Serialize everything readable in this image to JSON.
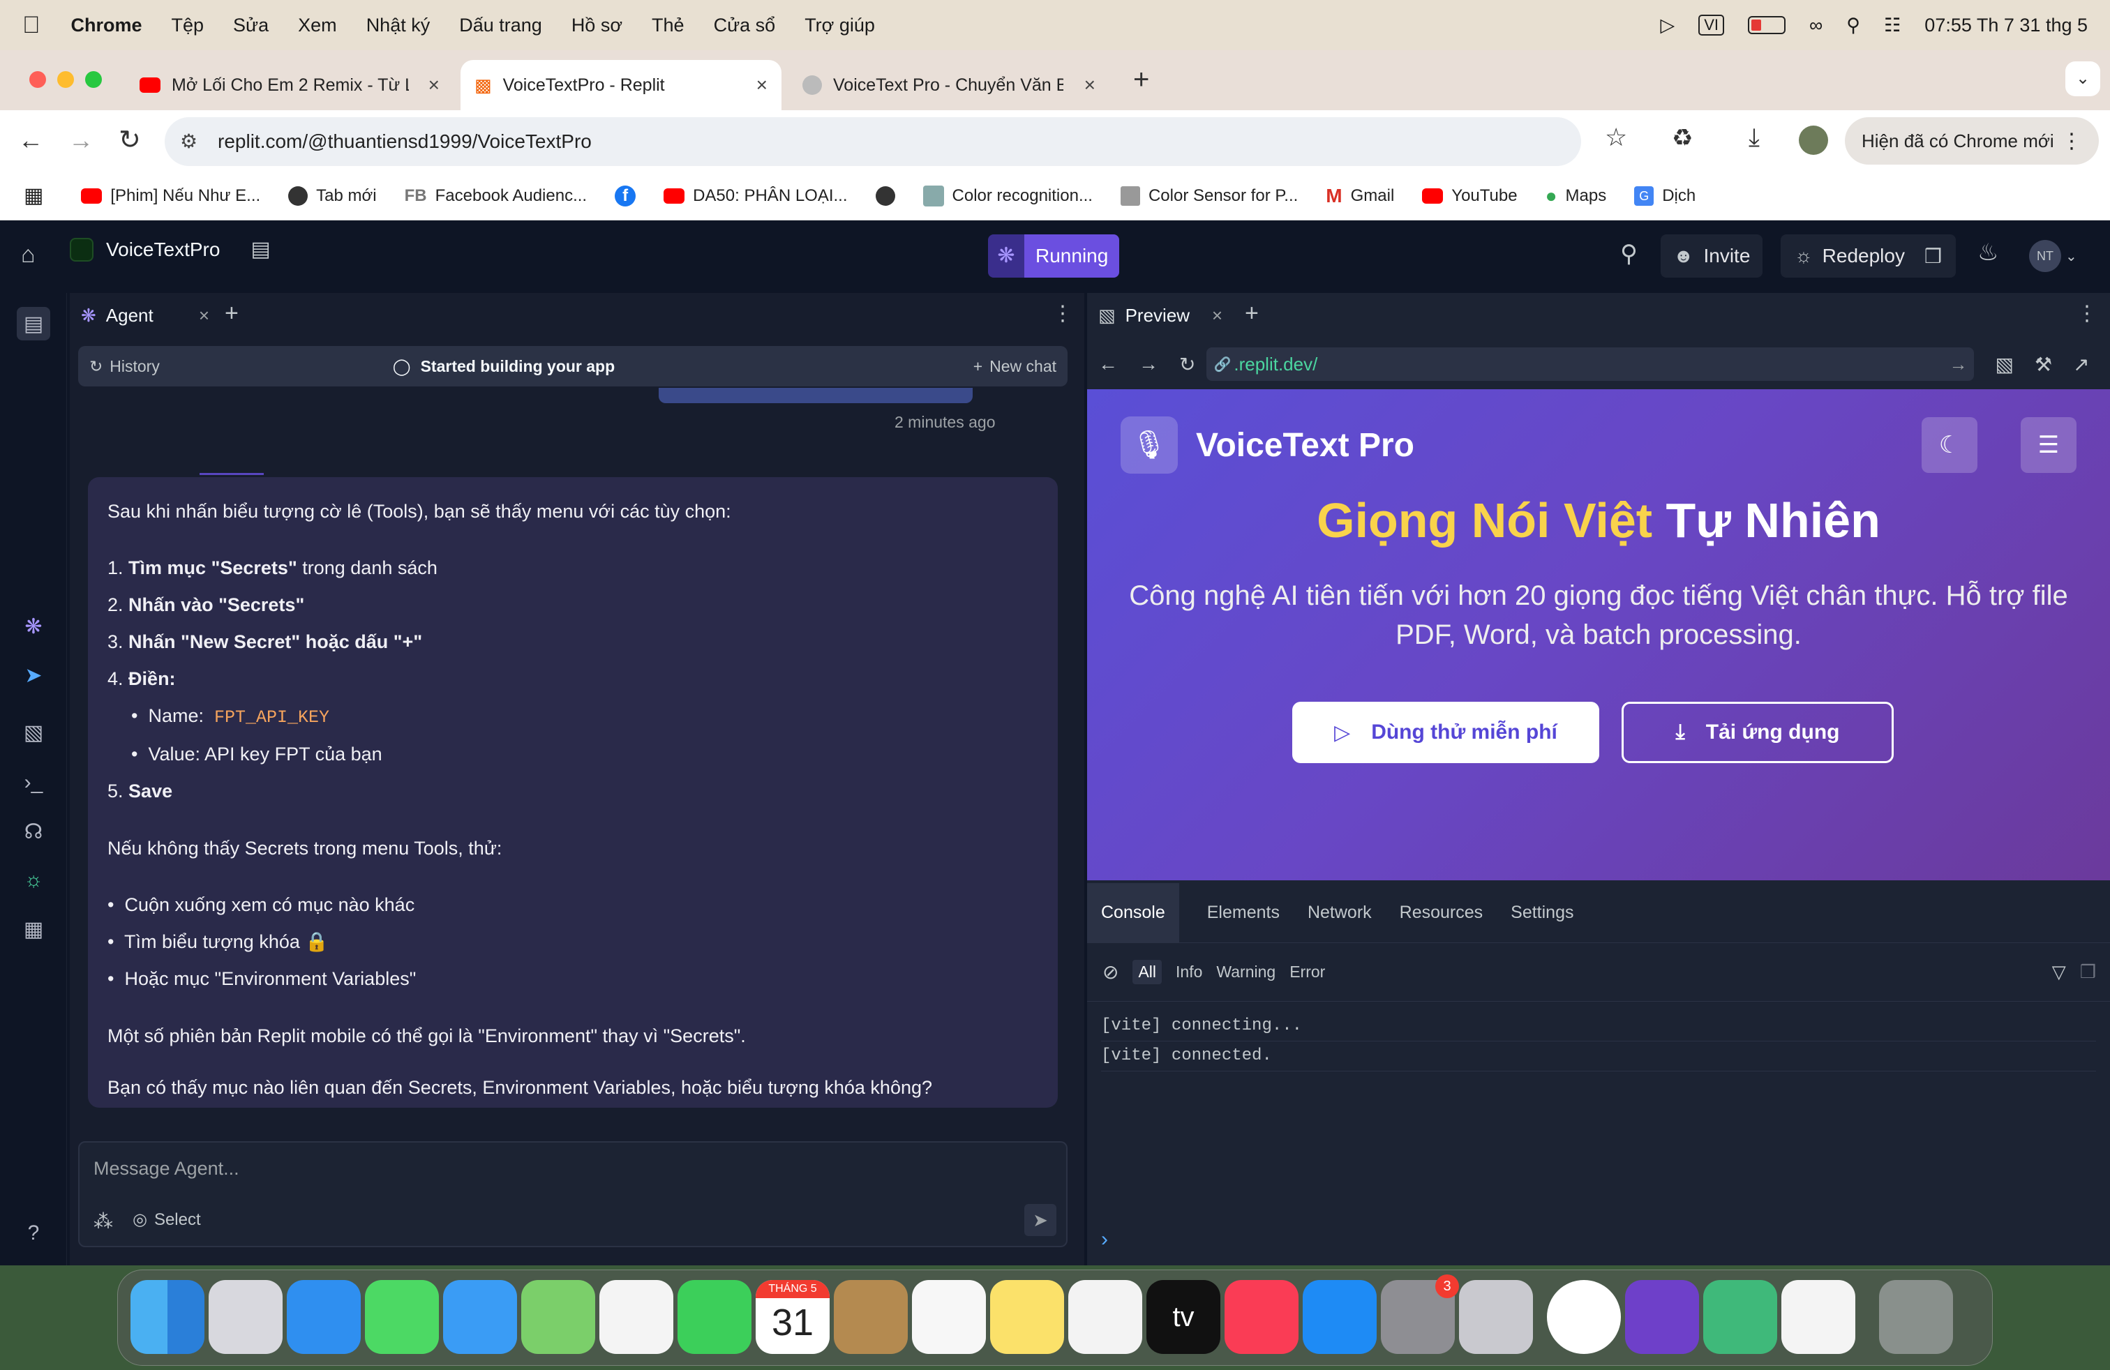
{
  "menubar": {
    "app": "Chrome",
    "items": [
      "Tệp",
      "Sửa",
      "Xem",
      "Nhật ký",
      "Dấu trang",
      "Hồ sơ",
      "Thẻ",
      "Cửa sổ",
      "Trợ giúp"
    ],
    "input_method": "VI",
    "clock": "07:55 Th 7 31 thg 5"
  },
  "tabs": [
    {
      "title": "Mở Lối Cho Em 2 Remix - Từ L",
      "icon": "youtube-icon"
    },
    {
      "title": "VoiceTextPro - Replit",
      "icon": "replit-icon"
    },
    {
      "title": "VoiceText Pro - Chuyển Văn B",
      "icon": "globe-icon"
    }
  ],
  "toolbar": {
    "url": "replit.com/@thuantiensd1999/VoiceTextPro",
    "update_label": "Hiện đã có Chrome mới"
  },
  "bookmarks": [
    "[Phim] Nếu Như E...",
    "Tab mới",
    "Facebook Audienc...",
    "",
    "DA50: PHÂN LOẠI...",
    "",
    "Color recognition...",
    "Color Sensor for P...",
    "Gmail",
    "YouTube",
    "Maps",
    "Dịch"
  ],
  "replit": {
    "project": "VoiceTextPro",
    "status": "Running",
    "invite": "Invite",
    "redeploy": "Redeploy",
    "avatar": "NT"
  },
  "agent": {
    "tab": "Agent",
    "history": "History",
    "session": "Started building your app",
    "new_chat": "New chat",
    "timestamp": "2 minutes ago",
    "placeholder": "Message Agent...",
    "select": "Select"
  },
  "message": {
    "intro": "Sau khi nhấn biểu tượng cờ lê (Tools), bạn sẽ thấy menu với các tùy chọn:",
    "steps": [
      {
        "n": "1.",
        "b": "Tìm mục \"Secrets\"",
        "t": " trong danh sách"
      },
      {
        "n": "2.",
        "b": "Nhấn vào \"Secrets\"",
        "t": ""
      },
      {
        "n": "3.",
        "b": "Nhấn \"New Secret\" hoặc dấu \"+\"",
        "t": ""
      },
      {
        "n": "4.",
        "b": "Điền:",
        "t": ""
      }
    ],
    "fill_name_label": "Name:",
    "fill_name_value": "FPT_API_KEY",
    "fill_value": "Value: API key FPT của bạn",
    "step5": "5.",
    "step5_b": "Save",
    "fallback": "Nếu không thấy Secrets trong menu Tools, thử:",
    "bullets": [
      "Cuộn xuống xem có mục nào khác",
      "Tìm biểu tượng khóa 🔒",
      "Hoặc mục \"Environment Variables\""
    ],
    "note": "Một số phiên bản Replit mobile có thể gọi là \"Environment\" thay vì \"Secrets\".",
    "question": "Bạn có thấy mục nào liên quan đến Secrets, Environment Variables, hoặc biểu tượng khóa không?"
  },
  "preview": {
    "tab": "Preview",
    "url": ".replit.dev/",
    "brand": "VoiceText Pro",
    "headline_a": "Giọng Nói Việt",
    "headline_b": " Tự Nhiên",
    "subtitle": "Công nghệ AI tiên tiến với hơn 20 giọng đọc tiếng Việt chân thực. Hỗ trợ file PDF, Word, và batch processing.",
    "cta_primary": "Dùng thử miễn phí",
    "cta_secondary": "Tải ứng dụng"
  },
  "devtools": {
    "tabs": [
      "Console",
      "Elements",
      "Network",
      "Resources",
      "Settings"
    ],
    "filters": [
      "All",
      "Info",
      "Warning",
      "Error"
    ],
    "logs": [
      "[vite] connecting...",
      "[vite] connected."
    ]
  },
  "dock": {
    "calendar_month": "THÁNG 5",
    "calendar_day": "31",
    "settings_badge": "3",
    "tv_label": "tv"
  }
}
